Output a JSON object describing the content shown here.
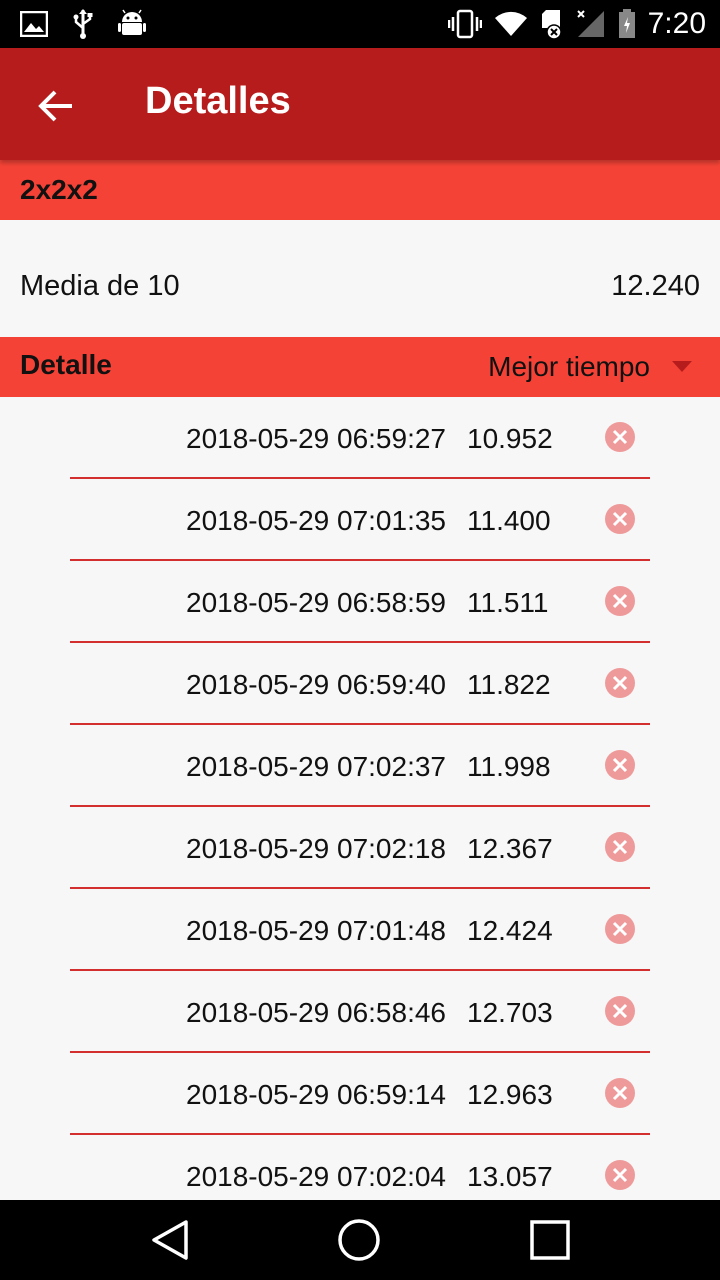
{
  "status_bar": {
    "time": "7:20",
    "icons_left": [
      "image-icon",
      "usb-icon",
      "android-icon"
    ],
    "icons_right": [
      "vibrate-icon",
      "wifi-icon",
      "sd-card-icon",
      "signal-icon",
      "battery-icon"
    ]
  },
  "app_bar": {
    "title": "Detalles",
    "back_icon": "arrow-back-icon",
    "color": "#b71c1c"
  },
  "puzzle": {
    "name": "2x2x2"
  },
  "average": {
    "label": "Media de 10",
    "value": "12.240"
  },
  "detail": {
    "title": "Detalle",
    "sort_selected": "Mejor tiempo",
    "header_color": "#f44336"
  },
  "solves": [
    {
      "date": "2018-05-29 06:59:27",
      "time": "10.952"
    },
    {
      "date": "2018-05-29 07:01:35",
      "time": "11.400"
    },
    {
      "date": "2018-05-29 06:58:59",
      "time": "11.511"
    },
    {
      "date": "2018-05-29 06:59:40",
      "time": "11.822"
    },
    {
      "date": "2018-05-29 07:02:37",
      "time": "11.998"
    },
    {
      "date": "2018-05-29 07:02:18",
      "time": "12.367"
    },
    {
      "date": "2018-05-29 07:01:48",
      "time": "12.424"
    },
    {
      "date": "2018-05-29 06:58:46",
      "time": "12.703"
    },
    {
      "date": "2018-05-29 06:59:14",
      "time": "12.963"
    },
    {
      "date": "2018-05-29 07:02:04",
      "time": "13.057"
    }
  ],
  "nav_bar": {
    "buttons": [
      "back-triangle-icon",
      "home-circle-icon",
      "recents-square-icon"
    ]
  }
}
